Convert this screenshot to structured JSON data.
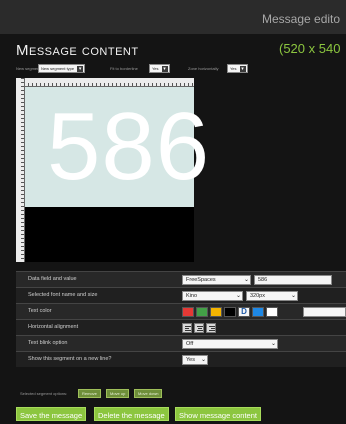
{
  "header": {
    "editor_title": "Message edito"
  },
  "section": {
    "title": "Message content",
    "size": "(520 x 540"
  },
  "options": {
    "new_segment_label": "New segment",
    "new_segment_value": "New segment type",
    "fit_border_label": "Fit to borderline",
    "fit_border_value": "Yes",
    "zone_horizontal_label": "Zone horizontally",
    "zone_horizontal_value": "Yes"
  },
  "preview": {
    "text": "586",
    "background_color": "#d6e7e5"
  },
  "properties": {
    "data_field_label": "Data field and value",
    "data_field_value": "FreeSpaces",
    "data_value": "586",
    "font_label": "Selected font name and size",
    "font_name": "Kino",
    "font_size": "320px",
    "text_color_label": "Text color",
    "colors": [
      "#e53935",
      "#43a047",
      "#f4b400",
      "#000000",
      "#f5f5f5",
      "#1e88e5",
      "#ffffff"
    ],
    "color_d": "D",
    "horizontal_alignment_label": "Horizontal alignment",
    "blink_label": "Text blink option",
    "blink_value": "Off",
    "new_line_label": "Show this segment on a new line?",
    "new_line_value": "Yes"
  },
  "segment_options": {
    "label": "Selected segment options:",
    "buttons": [
      "Remove",
      "Move up",
      "Move down"
    ]
  },
  "actions": {
    "save": "Save the message",
    "delete": "Delete the message",
    "show": "Show message content"
  }
}
